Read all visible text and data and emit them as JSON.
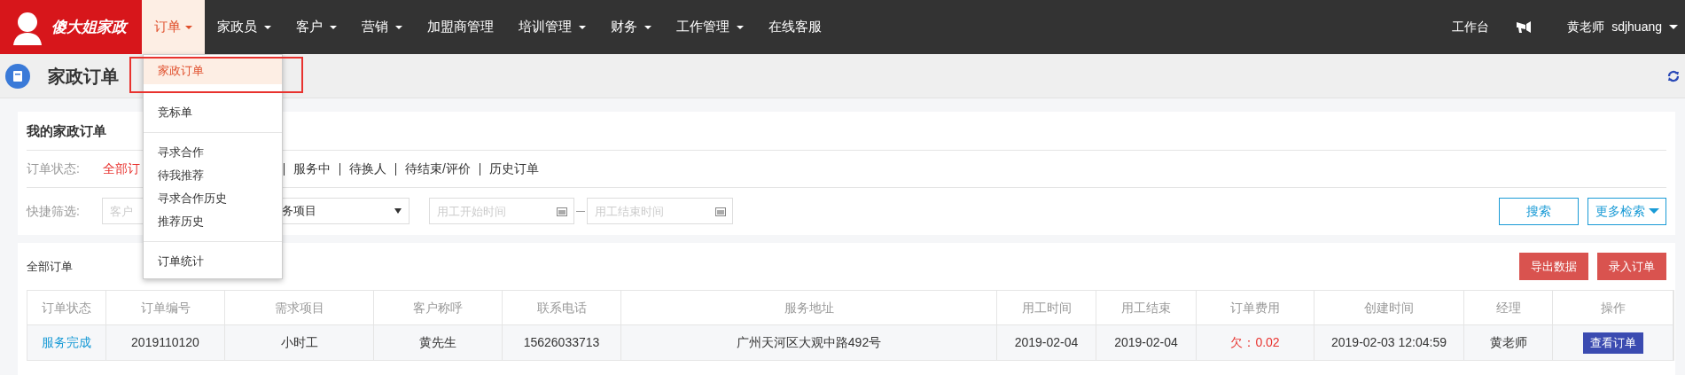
{
  "nav": {
    "logo_text": "傻大姐家政",
    "items": [
      {
        "label": "订单",
        "caret": true,
        "selected": true
      },
      {
        "label": "家政员",
        "caret": true,
        "selected": false
      },
      {
        "label": "客户",
        "caret": true,
        "selected": false
      },
      {
        "label": "营销",
        "caret": true,
        "selected": false
      },
      {
        "label": "加盟商管理",
        "caret": false,
        "selected": false
      },
      {
        "label": "培训管理",
        "caret": true,
        "selected": false
      },
      {
        "label": "财务",
        "caret": true,
        "selected": false
      },
      {
        "label": "工作管理",
        "caret": true,
        "selected": false
      },
      {
        "label": "在线客服",
        "caret": false,
        "selected": false
      }
    ],
    "workbench": "工作台",
    "user_name": "黄老师",
    "user_id": "sdjhuang"
  },
  "dropdown": {
    "groups": [
      [
        {
          "label": "家政订单",
          "selected": true,
          "outlined": true
        }
      ],
      [
        {
          "label": "竞标单",
          "selected": false,
          "outlined": false
        }
      ],
      [
        {
          "label": "寻求合作",
          "selected": false,
          "outlined": false
        },
        {
          "label": "待我推荐",
          "selected": false,
          "outlined": false
        },
        {
          "label": "寻求合作历史",
          "selected": false,
          "outlined": false
        },
        {
          "label": "推荐历史",
          "selected": false,
          "outlined": false
        }
      ],
      [
        {
          "label": "订单统计",
          "selected": false,
          "outlined": false
        }
      ]
    ]
  },
  "page_title": "家政订单",
  "filter_card": {
    "title": "我的家政订单",
    "status_label": "订单状态:",
    "status_tabs": [
      {
        "label": "全部订",
        "selected": true
      },
      {
        "label": "服务中",
        "selected": false
      },
      {
        "label": "待换人",
        "selected": false
      },
      {
        "label": "待结束/评价",
        "selected": false
      },
      {
        "label": "历史订单",
        "selected": false
      }
    ],
    "quick_label": "快捷筛选:",
    "customer_placeholder": "客户",
    "service_select": "务项目",
    "start_placeholder": "用工开始时间",
    "end_placeholder": "用工结束时间",
    "search_button": "搜索",
    "more_button": "更多检索"
  },
  "orders": {
    "title": "全部订单",
    "export_button": "导出数据",
    "add_button": "录入订单",
    "columns": [
      "订单状态",
      "订单编号",
      "需求项目",
      "客户称呼",
      "联系电话",
      "服务地址",
      "用工时间",
      "用工结束",
      "订单费用",
      "创建时间",
      "经理",
      "操作"
    ],
    "rows": [
      {
        "status": "服务完成",
        "order_no": "2019110120",
        "item": "小时工",
        "customer": "黄先生",
        "phone": "15626033713",
        "address": "广州天河区大观中路492号",
        "start": "2019-02-04",
        "end": "2019-02-04",
        "fee": "欠：0.02",
        "created": "2019-02-03 12:04:59",
        "manager": "黄老师",
        "action": "查看订单"
      }
    ]
  }
}
